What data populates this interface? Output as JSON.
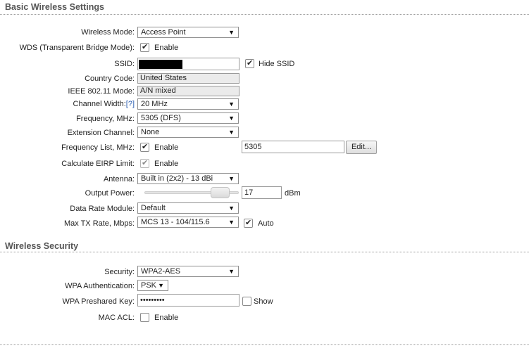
{
  "basic": {
    "title": "Basic Wireless Settings",
    "wireless_mode": {
      "label": "Wireless Mode:",
      "value": "Access Point"
    },
    "wds": {
      "label": "WDS (Transparent Bridge Mode):",
      "checkbox_label": "Enable",
      "checked": true
    },
    "ssid": {
      "label": "SSID:",
      "value": "",
      "hide_label": "Hide SSID",
      "hide_checked": true
    },
    "country_code": {
      "label": "Country Code:",
      "value": "United States"
    },
    "ieee_mode": {
      "label": "IEEE 802.11 Mode:",
      "value": "A/N mixed"
    },
    "channel_width": {
      "label": "Channel Width:",
      "help": "[?]",
      "value": "20 MHz"
    },
    "frequency": {
      "label": "Frequency, MHz:",
      "value": "5305 (DFS)"
    },
    "extension_channel": {
      "label": "Extension Channel:",
      "value": "None"
    },
    "frequency_list": {
      "label": "Frequency List, MHz:",
      "checkbox_label": "Enable",
      "checked": true,
      "value": "5305",
      "edit_label": "Edit..."
    },
    "eirp": {
      "label": "Calculate EIRP Limit:",
      "checkbox_label": "Enable",
      "checked": true
    },
    "antenna": {
      "label": "Antenna:",
      "value": "Built in (2x2) - 13 dBi"
    },
    "output_power": {
      "label": "Output Power:",
      "value": "17",
      "unit": "dBm",
      "slider_level": 0.88
    },
    "data_rate_module": {
      "label": "Data Rate Module:",
      "value": "Default"
    },
    "max_tx_rate": {
      "label": "Max TX Rate, Mbps:",
      "value": "MCS 13 - 104/115.6",
      "auto_label": "Auto",
      "auto_checked": true
    }
  },
  "security": {
    "title": "Wireless Security",
    "security": {
      "label": "Security:",
      "value": "WPA2-AES"
    },
    "wpa_auth": {
      "label": "WPA Authentication:",
      "value": "PSK"
    },
    "wpa_key": {
      "label": "WPA Preshared Key:",
      "value": "•••••••••",
      "show_label": "Show",
      "show_checked": false
    },
    "mac_acl": {
      "label": "MAC ACL:",
      "checkbox_label": "Enable",
      "checked": false
    }
  },
  "icons": {
    "caret": "▼"
  }
}
